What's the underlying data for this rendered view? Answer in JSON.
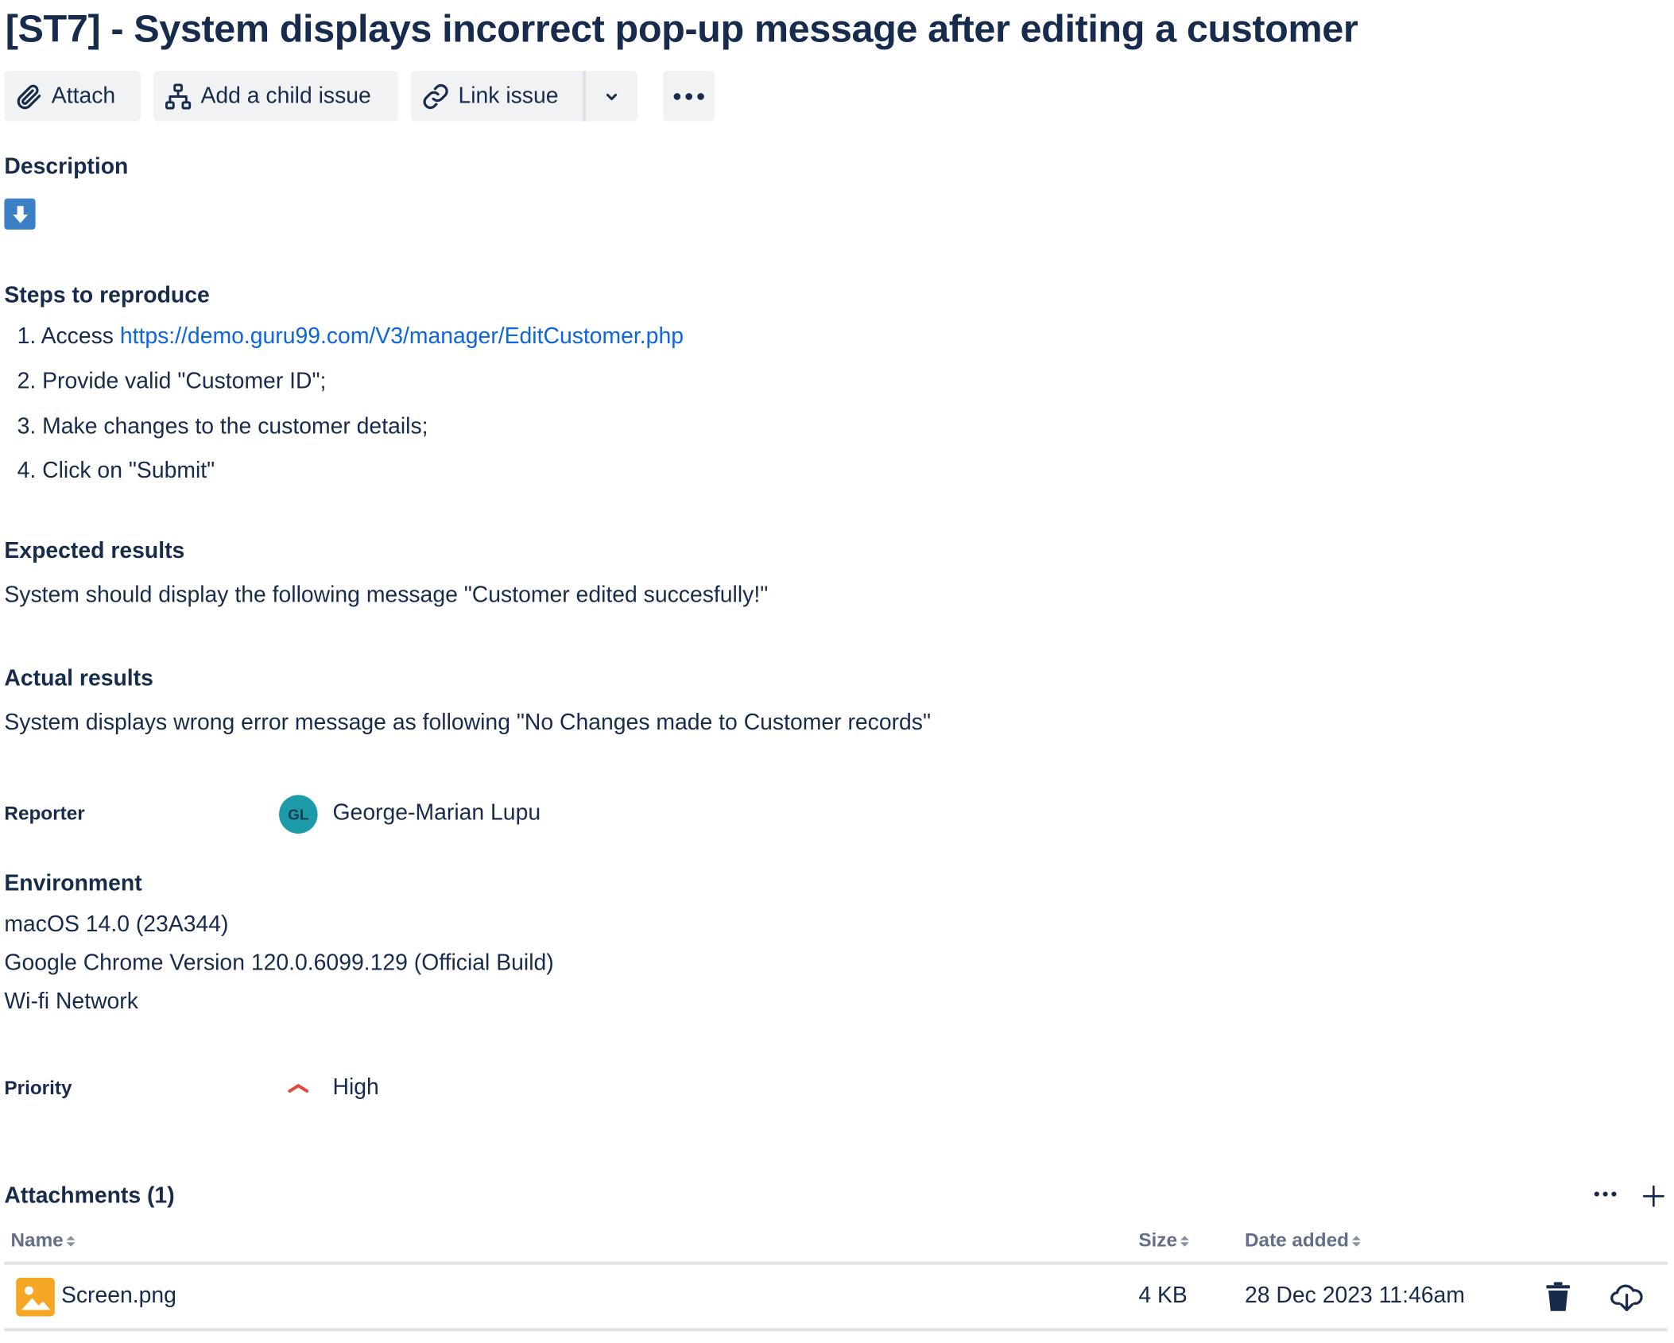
{
  "issue": {
    "title": "[ST7] - System displays incorrect pop-up message after editing a customer"
  },
  "toolbar": {
    "attach_label": "Attach",
    "child_issue_label": "Add a child issue",
    "link_issue_label": "Link issue"
  },
  "description": {
    "heading": "Description",
    "steps_heading": "Steps to reproduce",
    "steps": [
      {
        "num": "1.",
        "prefix": "Access ",
        "link": "https://demo.guru99.com/V3/manager/EditCustomer.php"
      },
      {
        "num": "2.",
        "text": "Provide valid \"Customer ID\";"
      },
      {
        "num": "3.",
        "text": "Make changes to the customer details;"
      },
      {
        "num": "4.",
        "text": "Click on \"Submit\""
      }
    ],
    "expected_heading": "Expected results",
    "expected_text": "System should display the following message \"Customer edited succesfully!\"",
    "actual_heading": "Actual results",
    "actual_text": "System displays wrong error message as following \"No Changes made to Customer records\""
  },
  "reporter": {
    "label": "Reporter",
    "initials": "GL",
    "name": "George-Marian Lupu",
    "avatar_color": "#1d9aaa"
  },
  "environment": {
    "heading": "Environment",
    "lines": [
      "macOS 14.0 (23A344)",
      "Google Chrome Version 120.0.6099.129 (Official Build)",
      "Wi-fi Network"
    ]
  },
  "priority": {
    "label": "Priority",
    "value": "High",
    "icon": "priority-high-icon",
    "color": "#e2483d"
  },
  "attachments": {
    "heading": "Attachments (1)",
    "columns": {
      "name": "Name",
      "size": "Size",
      "date": "Date added"
    },
    "rows": [
      {
        "name": "Screen.png",
        "size": "4 KB",
        "date": "28 Dec 2023 11:46am",
        "icon": "image-file-icon",
        "icon_color": "#f5a623"
      }
    ]
  },
  "colors": {
    "text": "#172b4d",
    "link": "#0c66e4",
    "button_bg": "#f1f2f4",
    "description_icon_bg": "#3b7fc4"
  }
}
